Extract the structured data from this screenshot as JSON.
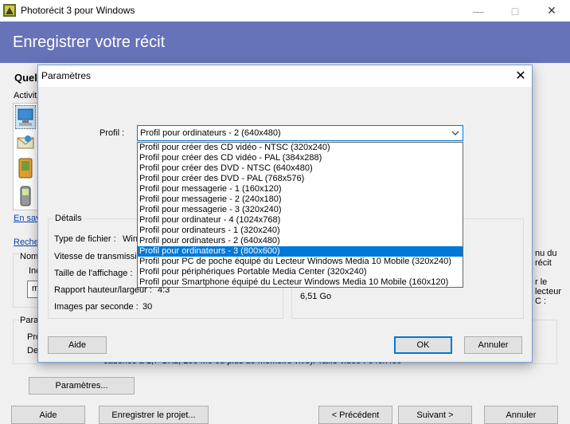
{
  "app": {
    "title": "Photorécit 3 pour Windows",
    "min_icon": "minimize-icon",
    "max_icon": "maximize-icon",
    "close_icon": "close-icon"
  },
  "banner": {
    "title": "Enregistrer votre récit"
  },
  "main": {
    "heading_partial": "Quel",
    "activity_partial": "Activit",
    "link_save_partial": "En sav",
    "link_search_partial": "Reche",
    "name_label_partial": "Nom",
    "ind_label_partial": "Inc",
    "input_partial": "m",
    "params_section_partial": "Para",
    "pro_label_partial": "Pro",
    "des_label_partial": "De",
    "description_text": "cadence à 1,7 GHz, 256 Mo ou plus de mémoire vive). Taille vidéo : 640x480",
    "parametres_button": "Paramètres...",
    "right_text_1": "nu du récit",
    "right_text_2": "r le lecteur C :"
  },
  "footer": {
    "help": "Aide",
    "save_project": "Enregistrer le projet...",
    "previous": "< Précédent",
    "next": "Suivant >",
    "cancel": "Annuler"
  },
  "dialog": {
    "title": "Paramètres",
    "profile_label": "Profil :",
    "profile_value": "Profil pour ordinateurs - 2 (640x480)",
    "dropdown_options": [
      "Profil pour créer des CD vidéo - NTSC (320x240)",
      "Profil pour créer des CD vidéo - PAL (384x288)",
      "Profil pour créer des DVD - NTSC (640x480)",
      "Profil pour créer des DVD - PAL (768x576)",
      "Profil pour messagerie - 1 (160x120)",
      "Profil pour messagerie - 2 (240x180)",
      "Profil pour messagerie - 3 (320x240)",
      "Profil pour ordinateur - 4 (1024x768)",
      "Profil pour ordinateurs - 1 (320x240)",
      "Profil pour ordinateurs - 2 (640x480)",
      "Profil pour ordinateurs - 3 (800x600)",
      "Profil pour PC de poche équipé du Lecteur Windows Media 10 Mobile (320x240)",
      "Profil pour périphériques Portable Media Center (320x240)",
      "Profil pour Smartphone équipé du Lecteur Windows Media 10 Mobile (160x120)"
    ],
    "highlighted_index": 10,
    "details_label": "Détails",
    "details": {
      "file_type_label": "Type de fichier :",
      "file_type_value": "Win",
      "bitrate_label": "Vitesse de transmissio",
      "display_size_label": "Taille de l'affichage :",
      "aspect_label": "Rapport hauteur/largeur :",
      "aspect_value": "4:3",
      "fps_label": "Images par seconde :",
      "fps_value": "30"
    },
    "disk_space_value": "6,51 Go",
    "help": "Aide",
    "ok": "OK",
    "cancel": "Annuler"
  }
}
